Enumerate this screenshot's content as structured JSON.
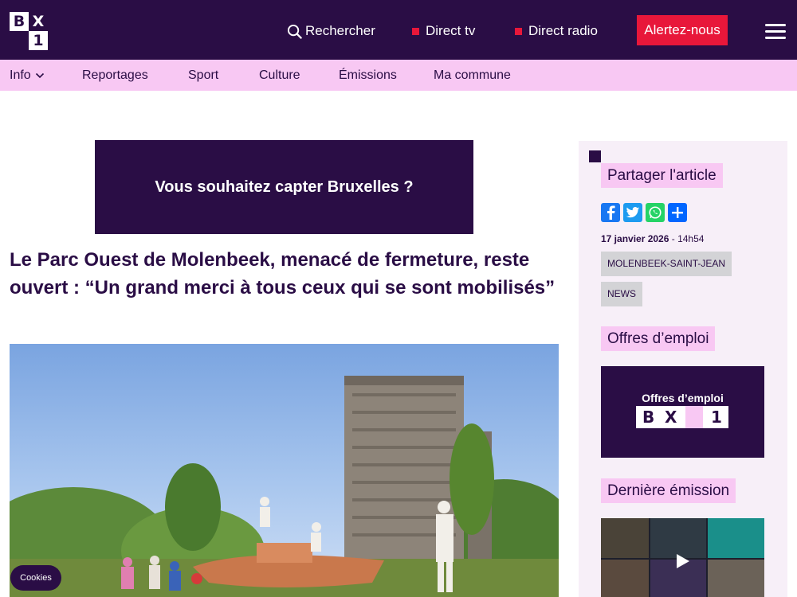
{
  "header": {
    "logo": {
      "letters": [
        "B",
        "X",
        "1"
      ]
    },
    "search_label": "Rechercher",
    "direct_tv_label": "Direct tv",
    "direct_radio_label": "Direct radio",
    "alert_label": "Alertez-nous",
    "live_indicator_color": "#e8173a",
    "brand_color": "#2a0d45"
  },
  "subnav": {
    "items": [
      {
        "label": "Info"
      },
      {
        "label": "Reportages"
      },
      {
        "label": "Sport"
      },
      {
        "label": "Culture"
      },
      {
        "label": "Émissions"
      },
      {
        "label": "Ma commune"
      }
    ],
    "background": "#f8c8f3"
  },
  "article": {
    "banner_text": "Vous souhaitez capter Bruxelles ?",
    "headline": "Le Parc Ouest de Molenbeek, menacé de fermeture, reste ouvert : “Un grand merci à tous ceux qui se sont mobilisés”"
  },
  "sidebar": {
    "share_title": "Partager l'article",
    "share_icons": [
      "facebook-icon",
      "twitter-icon",
      "whatsapp-icon",
      "share-icon"
    ],
    "date": "17 janvier 2026",
    "time": "- 14h54",
    "tags": [
      "MOLENBEEK-SAINT-JEAN",
      "NEWS"
    ],
    "jobs_title": "Offres d’emploi",
    "jobs_card_text": "Offres d’emploi",
    "jobs_card_logo": [
      "B",
      "X",
      "1"
    ],
    "last_emission_title": "Dernière émission"
  },
  "cookies_label": "Cookies"
}
